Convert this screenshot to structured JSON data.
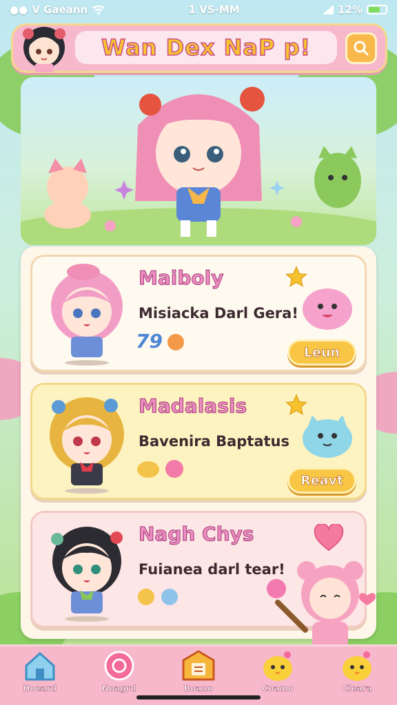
{
  "status_bar": {
    "carrier": "V Gaeann",
    "time": "1 VS-MM",
    "battery": "12%"
  },
  "header": {
    "title": "Wan Dex NaP p!"
  },
  "cards": [
    {
      "name": "Maiboly",
      "desc": "Misiacka Darl Gera!",
      "button": "Leun",
      "mini_text": "79"
    },
    {
      "name": "Madalasis",
      "desc": "Bavenira Baptatus",
      "button": "Reavt"
    },
    {
      "name": "Nagh Chys",
      "desc": "Fuianea darl tear!"
    }
  ],
  "nav": [
    {
      "label": "Hoeard",
      "icon": "home-icon"
    },
    {
      "label": "Noagrd",
      "icon": "refresh-icon"
    },
    {
      "label": "Boano",
      "icon": "list-icon"
    },
    {
      "label": "Coamo",
      "icon": "chick-icon"
    },
    {
      "label": "Cleara",
      "icon": "chick-icon"
    }
  ]
}
